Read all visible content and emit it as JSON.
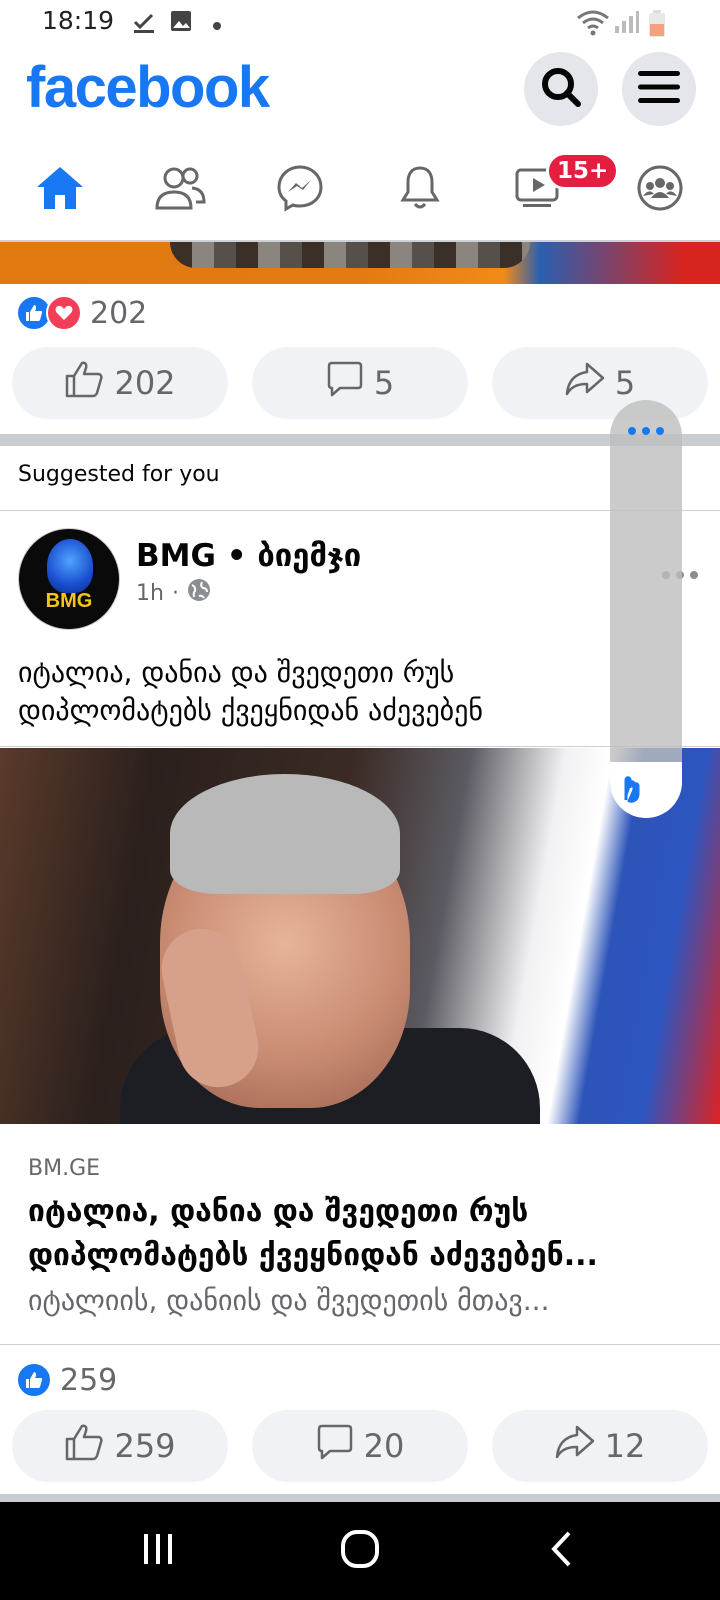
{
  "status_bar": {
    "time": "18:19",
    "icons": [
      "download-done-icon",
      "image-icon",
      "dot-icon",
      "wifi-icon",
      "signal-icon",
      "battery-low-icon"
    ]
  },
  "header": {
    "logo": "facebook",
    "search_icon": "search-icon",
    "menu_icon": "menu-icon",
    "brand_color": "#1877f2"
  },
  "tabs": {
    "items": [
      "home-icon",
      "friends-icon",
      "messenger-icon",
      "bell-icon",
      "watch-icon",
      "groups-icon"
    ],
    "active": "home",
    "watch_badge": "15+"
  },
  "post1": {
    "reaction_count": "202",
    "like_count": "202",
    "comment_count": "5",
    "share_count": "5"
  },
  "suggested": {
    "label": "Suggested for you"
  },
  "post2": {
    "page_name": "BMG • ბიემჯი",
    "avatar_text": "BMG",
    "time": "1h",
    "text": "იტალია, დანია და შვედეთი რუს დიპლომატებს ქვეყნიდან აძევებენ",
    "link": {
      "domain": "BM.GE",
      "title": "იტალია, დანია და შვედეთი რუს დიპლომატებს ქვეყნიდან აძევებენ...",
      "description": "იტალიის, დანიის და შვედეთის მთავ..."
    },
    "reaction_count": "259",
    "like_count": "259",
    "comment_count": "20",
    "share_count": "12"
  }
}
